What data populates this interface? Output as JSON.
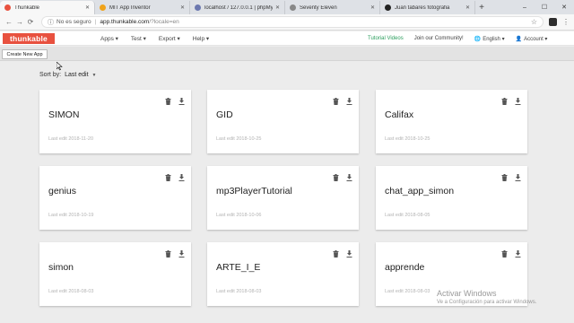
{
  "browser": {
    "tabs": [
      {
        "title": "Thunkable",
        "favicon_color": "#e8513f",
        "active": true
      },
      {
        "title": "MIT App Inventor",
        "favicon_color": "#f0a31a",
        "active": false
      },
      {
        "title": "localhost / 127.0.0.1 | phpMyA",
        "favicon_color": "#6c78af",
        "active": false
      },
      {
        "title": "Seventy Eleven",
        "favicon_color": "#888888",
        "active": false
      },
      {
        "title": "Juan tabares fotografia",
        "favicon_color": "#222222",
        "active": false
      }
    ],
    "new_tab": "+",
    "window_controls": [
      "–",
      "☐",
      "✕"
    ],
    "back": "←",
    "forward": "→",
    "reload": "C",
    "security_text": "No es seguro",
    "url_host": "app.thunkable.com",
    "url_rest": "/?locale=en"
  },
  "header": {
    "logo": "thunkable",
    "menu": [
      "Apps ▾",
      "Test ▾",
      "Export ▾",
      "Help ▾"
    ],
    "tutorial_videos": "Tutorial Videos",
    "community": "Join our Community!",
    "language": "English ▾",
    "account": "Account ▾"
  },
  "toolbar": {
    "create_label": "Create New App"
  },
  "sort": {
    "label": "Sort by:",
    "value": "Last edit"
  },
  "apps": [
    {
      "name": "SIMON",
      "last_edit": "Last edit 2018-11-20"
    },
    {
      "name": "GID",
      "last_edit": "Last edit 2018-10-25"
    },
    {
      "name": "Califax",
      "last_edit": "Last edit 2018-10-25"
    },
    {
      "name": "genius",
      "last_edit": "Last edit 2018-10-19"
    },
    {
      "name": "mp3PlayerTutorial",
      "last_edit": "Last edit 2018-10-06"
    },
    {
      "name": "chat_app_simon",
      "last_edit": "Last edit 2018-08-05"
    },
    {
      "name": "simon",
      "last_edit": "Last edit 2018-08-03"
    },
    {
      "name": "ARTE_I_E",
      "last_edit": "Last edit 2018-08-03"
    },
    {
      "name": "apprende",
      "last_edit": "Last edit 2018-08-03"
    }
  ],
  "watermark": {
    "line1": "Activar Windows",
    "line2": "Ve a Configuración para activar Windows."
  }
}
